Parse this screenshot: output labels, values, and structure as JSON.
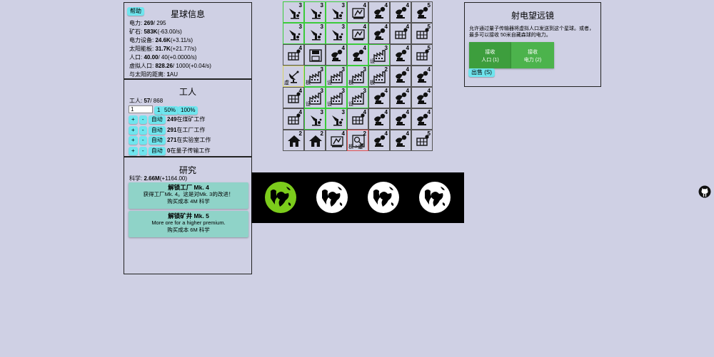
{
  "planet_info": {
    "help_label": "帮助",
    "title": "星球信息",
    "rows": [
      {
        "label": "电力: ",
        "value": "269",
        "extra": "/ 295"
      },
      {
        "label": "矿石: ",
        "value": "583K",
        "extra": "(-63.00/s)"
      },
      {
        "label": "电力设备: ",
        "value": "24.6K",
        "extra": "(+3.11/s)"
      },
      {
        "label": "太阳能板: ",
        "value": "31.7K",
        "extra": "(+21.77/s)"
      },
      {
        "label": "人口: ",
        "value": "40.00",
        "extra": "/ 40(+0.0000/s)"
      },
      {
        "label": "虚拟人口: ",
        "value": "828.26",
        "extra": "/ 1000(+0.04/s)"
      },
      {
        "label": "与太阳的距离: ",
        "value": "1",
        "extra": "AU"
      }
    ]
  },
  "workers": {
    "title": "工人",
    "count_label": "工人: ",
    "count_value": "57",
    "count_total": "/ 868",
    "input_value": "1",
    "one_label": "1",
    "fifty_label": "50%",
    "hundred_label": "100%",
    "plus_label": "+",
    "minus_label": "-",
    "auto_label": "自动",
    "jobs": [
      {
        "value": "249",
        "label": "在煤矿工作"
      },
      {
        "value": "291",
        "label": "在工厂工作"
      },
      {
        "value": "271",
        "label": "在实验室工作"
      },
      {
        "value": "0",
        "label": "在量子传输工作"
      }
    ]
  },
  "research": {
    "title": "研究",
    "science_label": "科学: ",
    "science_value": "2.66M",
    "science_rate": "(+1164.00)",
    "cards": [
      {
        "title": "解锁工厂 Mk. 4",
        "desc": "获得工厂Mk. 4。这是对Mk. 3的改进！",
        "cost": "购买成本 4M 科学"
      },
      {
        "title": "解锁矿井 Mk. 5",
        "desc": "More ore for a higher premium.",
        "cost": "购买成本 6M 科学"
      }
    ]
  },
  "telescope": {
    "title": "射电望远镜",
    "desc": "允许通过量子传输器将虚拟人口发送到这个星球。或者，最多可以接收 50米自藏森球的电力。",
    "receive_pop_line1": "接收",
    "receive_pop_line2": "人口 (1)",
    "receive_power_line1": "接收",
    "receive_power_line2": "电力 (2)",
    "sell_label": "出售 (S)"
  },
  "grid": [
    [
      {
        "icon": "drill",
        "lvl": "3",
        "b": "g"
      },
      {
        "icon": "drill",
        "lvl": "3",
        "b": "g"
      },
      {
        "icon": "drill",
        "lvl": "3",
        "b": "g"
      },
      {
        "icon": "lab",
        "lvl": "4",
        "b": ""
      },
      {
        "icon": "satellite",
        "lvl": "4",
        "b": ""
      },
      {
        "icon": "satellite",
        "lvl": "4",
        "b": ""
      },
      {
        "icon": "satellite",
        "lvl": "5",
        "b": ""
      }
    ],
    [
      {
        "icon": "drill",
        "lvl": "3",
        "b": "g"
      },
      {
        "icon": "drill",
        "lvl": "3",
        "b": "g"
      },
      {
        "icon": "drill",
        "lvl": "3",
        "b": "g"
      },
      {
        "icon": "lab",
        "lvl": "4",
        "b": "g"
      },
      {
        "icon": "satellite",
        "lvl": "4",
        "b": ""
      },
      {
        "icon": "solar",
        "lvl": "4",
        "b": ""
      },
      {
        "icon": "solar",
        "lvl": "5",
        "b": ""
      }
    ],
    [
      {
        "icon": "solar",
        "lvl": "4",
        "b": ""
      },
      {
        "icon": "storage",
        "lvl": "",
        "b": ""
      },
      {
        "icon": "satellite",
        "lvl": "4",
        "b": ""
      },
      {
        "icon": "satellite",
        "lvl": "4",
        "b": "g"
      },
      {
        "icon": "factory",
        "lvl": "3",
        "b": "g",
        "tag": "设"
      },
      {
        "icon": "satellite",
        "lvl": "4",
        "b": ""
      },
      {
        "icon": "solar",
        "lvl": "5",
        "b": ""
      }
    ],
    [
      {
        "icon": "dish",
        "lvl": "",
        "b": "y",
        "tag": "虚"
      },
      {
        "icon": "factory",
        "lvl": "3",
        "b": "g",
        "tag": "板"
      },
      {
        "icon": "factory",
        "lvl": "3",
        "b": "g",
        "tag": "设"
      },
      {
        "icon": "factory",
        "lvl": "3",
        "b": "g",
        "tag": "板"
      },
      {
        "icon": "factory",
        "lvl": "2",
        "b": "",
        "tag": "板"
      },
      {
        "icon": "satellite",
        "lvl": "4",
        "b": ""
      },
      {
        "icon": "satellite",
        "lvl": "4",
        "b": ""
      }
    ],
    [
      {
        "icon": "solar",
        "lvl": "4",
        "b": ""
      },
      {
        "icon": "factory",
        "lvl": "3",
        "b": "g",
        "tag": "设"
      },
      {
        "icon": "factory",
        "lvl": "3",
        "b": "g",
        "tag": "设"
      },
      {
        "icon": "factory",
        "lvl": "3",
        "b": "g",
        "tag": "设"
      },
      {
        "icon": "satellite",
        "lvl": "4",
        "b": ""
      },
      {
        "icon": "satellite",
        "lvl": "4",
        "b": ""
      },
      {
        "icon": "satellite",
        "lvl": "4",
        "b": ""
      }
    ],
    [
      {
        "icon": "solar",
        "lvl": "4",
        "b": ""
      },
      {
        "icon": "drill",
        "lvl": "3",
        "b": "g"
      },
      {
        "icon": "drill",
        "lvl": "3",
        "b": "g"
      },
      {
        "icon": "solar",
        "lvl": "4",
        "b": ""
      },
      {
        "icon": "satellite",
        "lvl": "4",
        "b": ""
      },
      {
        "icon": "satellite",
        "lvl": "4",
        "b": ""
      },
      {
        "icon": "satellite",
        "lvl": "4",
        "b": ""
      }
    ],
    [
      {
        "icon": "house",
        "lvl": "2",
        "b": ""
      },
      {
        "icon": "house",
        "lvl": "2",
        "b": ""
      },
      {
        "icon": "lab",
        "lvl": "4",
        "b": ""
      },
      {
        "icon": "quantum",
        "lvl": "2",
        "b": "r",
        "tag": "板->虚"
      },
      {
        "icon": "satellite",
        "lvl": "4",
        "b": ""
      },
      {
        "icon": "satellite",
        "lvl": "4",
        "b": ""
      },
      {
        "icon": "solar",
        "lvl": "5",
        "b": ""
      }
    ]
  ],
  "planets": [
    {
      "name": "planet-1",
      "color": "#7ccc1c",
      "active": true
    },
    {
      "name": "planet-2",
      "color": "#ffffff",
      "active": false
    },
    {
      "name": "planet-3",
      "color": "#ffffff",
      "active": false
    },
    {
      "name": "planet-4",
      "color": "#ffffff",
      "active": false
    }
  ],
  "colors": {
    "background": "#cfd0e4",
    "button": "#6fe5ee",
    "research_card": "#8fd3c8",
    "telescope_button": "#38a838",
    "active_planet": "#7ccc1c"
  }
}
